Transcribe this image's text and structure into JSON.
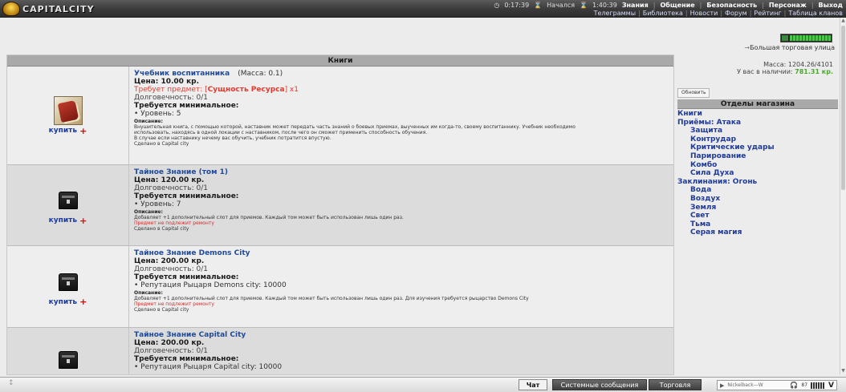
{
  "header": {
    "logo_text": "CAPITALCITY",
    "clock1": "0:17:39",
    "started_label": "Начался",
    "clock2": "1:40:39",
    "nav_main": [
      "Знания",
      "Общение",
      "Безопасность",
      "Персонаж",
      "Выход"
    ],
    "nav_links": [
      "Телеграммы",
      "Библиотека",
      "Новости",
      "Форум",
      "Рейтинг",
      "Таблица кланов"
    ]
  },
  "location": {
    "arrow": "→",
    "name": "Большая торговая улица"
  },
  "table": {
    "header": "Книги",
    "buy_label": "купить",
    "items": [
      {
        "name": "Учебник воспитанника",
        "mass": "(Масса: 0.1)",
        "price": "Цена: 10.00 кр.",
        "requires_prefix": "Требует предмет: [",
        "requires_item": "Сущность Ресурса",
        "requires_suffix": "] x1",
        "durability": "Долговечность: 0/1",
        "min_title": "Требуется минимальное:",
        "requirements": [
          "• Уровень: 5"
        ],
        "desc_title": "Описание:",
        "desc": [
          "Внушительная книга, с помощью которой, наставник может передать часть знаний о боевых приемах, выученных им когда-то, своему воспитаннику. Учебник необходимо",
          "использовать, находясь в одной локации с наставником, после чего он сможет применить способность обучения.",
          "В случае если наставнику нечему вас обучить, учебник потратится впустую."
        ],
        "no_repair": "",
        "made_in": "Сделано в Capital city"
      },
      {
        "name": "Тайное Знание (том 1)",
        "mass": "",
        "price": "Цена: 120.00 кр.",
        "durability": "Долговечность: 0/1",
        "min_title": "Требуется минимальное:",
        "requirements": [
          "• Уровень: 7"
        ],
        "desc_title": "Описание:",
        "desc": [
          "Добавляет +1 дополнительный слот для приемов. Каждый том может быть использован лишь один раз."
        ],
        "no_repair": "Предмет не подлежит ремонту",
        "made_in": "Сделано в Capital city"
      },
      {
        "name": "Тайное Знание Demons City",
        "mass": "",
        "price": "Цена: 200.00 кр.",
        "durability": "Долговечность: 0/1",
        "min_title": "Требуется минимальное:",
        "requirements": [
          "• Репутация Рыцаря Demons city: 10000"
        ],
        "desc_title": "Описание:",
        "desc": [
          "Добавляет +1 дополнительный слот для приемов. Каждый том может быть использован лишь один раз. Для изучения требуется рыцарство Demons City"
        ],
        "no_repair": "Предмет не подлежит ремонту",
        "made_in": "Сделано в Capital city"
      },
      {
        "name": "Тайное Знание Capital City",
        "mass": "",
        "price": "Цена: 200.00 кр.",
        "durability": "Долговечность: 0/1",
        "min_title": "Требуется минимальное:",
        "requirements": [
          "• Репутация Рыцаря Capital city: 10000"
        ],
        "desc_title": "",
        "desc": [],
        "no_repair": "",
        "made_in": ""
      }
    ]
  },
  "sidebar": {
    "mass": "Масса: 1204.26/4101",
    "money_label": "У вас в наличии:",
    "money_value": "781.31 кр.",
    "refresh_label": "Обновить",
    "departments_title": "Отделы магазина",
    "departments": [
      {
        "label": "Книги",
        "sub": false
      },
      {
        "label": "Приёмы: Атака",
        "sub": false
      },
      {
        "label": "Защита",
        "sub": true
      },
      {
        "label": "Контрудар",
        "sub": true
      },
      {
        "label": "Критические удары",
        "sub": true
      },
      {
        "label": "Парирование",
        "sub": true
      },
      {
        "label": "Комбо",
        "sub": true
      },
      {
        "label": "Сила Духа",
        "sub": true
      },
      {
        "label": "Заклинания: Огонь",
        "sub": false
      },
      {
        "label": "Вода",
        "sub": true
      },
      {
        "label": "Воздух",
        "sub": true
      },
      {
        "label": "Земля",
        "sub": true
      },
      {
        "label": "Свет",
        "sub": true
      },
      {
        "label": "Тьма",
        "sub": true
      },
      {
        "label": "Серая магия",
        "sub": true
      }
    ]
  },
  "bottom": {
    "tabs": [
      "Чат",
      "Системные сообщения",
      "Торговля"
    ],
    "player_track": "Nickelback—W",
    "player_volume": "87",
    "player_logo": "V"
  }
}
